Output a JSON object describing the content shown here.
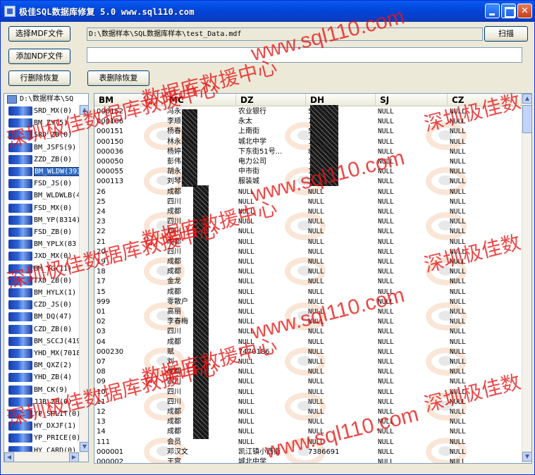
{
  "window": {
    "title": "极佳SQL数据库修复 5.0 www.sql110.com"
  },
  "toolbar": {
    "select_mdf": "选择MDF文件",
    "add_ndf": "添加NDF文件",
    "row_delete_recover": "行删除恢复",
    "table_delete_recover": "表删除恢复",
    "scan": "扫描",
    "mdf_path": "D:\\数据样本\\SQL数据库样本\\test_Data.mdf",
    "ndf_path": ""
  },
  "tree": {
    "root": "D:\\数据样本\\SQ",
    "items": [
      "SRD_MX(0)",
      "BM_ZY(5)",
      "SRD_ZB(0)",
      "BM_JSFS(9)",
      "ZZD_ZB(0)",
      "BM_WLDW(393",
      "FSD_JS(0)",
      "BM_WLDWLB(4",
      "FSD_MX(0)",
      "BM_YP(8314)",
      "FSD_ZB(0)",
      "BM_YPLX(83",
      "JXD_MX(0)",
      "BM_YG(11)",
      "TXD_ZB(0)",
      "BM_HYLX(1)",
      "CZD_JS(0)",
      "BM_DQ(47)",
      "CZD_ZB(0)",
      "BM_SCCJ(419",
      "YHD_MX(7018",
      "BM_QXZ(2)",
      "YHD_ZB(4)",
      "BM_CK(9)",
      "JJB_ZB(0)",
      "YP_SPLIT(0)",
      "HY_DXJF(1)",
      "YP_PRICE(0)",
      "HY_CARD(0)"
    ],
    "selected_index": 5
  },
  "grid": {
    "columns": [
      "BM",
      "MC",
      "DZ",
      "DH",
      "SJ",
      "CZ"
    ],
    "rows": [
      [
        "000152",
        "冯永",
        "农业银行",
        "5",
        "NULL",
        "NULL"
      ],
      [
        "000106",
        "李顺",
        "永太",
        "7",
        "NULL",
        "NULL"
      ],
      [
        "000151",
        "杨春",
        "上南街",
        "5",
        "NULL",
        "NULL"
      ],
      [
        "000150",
        "林永",
        "城北中学",
        "1",
        "NULL",
        "NULL"
      ],
      [
        "000036",
        "杨婷",
        "下东街51号...",
        "8",
        "NULL",
        "NULL"
      ],
      [
        "000050",
        "彭伟",
        "电力公司",
        "1",
        "NULL",
        "NULL"
      ],
      [
        "000055",
        "胡永",
        "中市街",
        "1",
        "NULL",
        "NULL"
      ],
      [
        "000113",
        "刘琴",
        "服装城",
        "1",
        "NULL",
        "NULL"
      ],
      [
        "26",
        "成都",
        "NULL",
        "NULL",
        "NULL",
        "NULL"
      ],
      [
        "25",
        "四川",
        "NULL",
        "NULL",
        "NULL",
        "NULL"
      ],
      [
        "24",
        "成都",
        "NULL",
        "NULL",
        "NULL",
        "NULL"
      ],
      [
        "23",
        "四川",
        "NULL",
        "NULL",
        "NULL",
        "NULL"
      ],
      [
        "22",
        "四川",
        "NULL",
        "NULL",
        "NULL",
        "NULL"
      ],
      [
        "21",
        "成都",
        "NULL",
        "NULL",
        "NULL",
        "NULL"
      ],
      [
        "20",
        "四川",
        "NULL",
        "NULL",
        "NULL",
        "NULL"
      ],
      [
        "19",
        "成都",
        "NULL",
        "NULL",
        "NULL",
        "NULL"
      ],
      [
        "18",
        "成都",
        "NULL",
        "NULL",
        "NULL",
        "NULL"
      ],
      [
        "17",
        "金龙",
        "NULL",
        "NULL",
        "NULL",
        "NULL"
      ],
      [
        "15",
        "成都",
        "NULL",
        "NULL",
        "NULL",
        "NULL"
      ],
      [
        "999",
        "零散户",
        "NULL",
        "NULL",
        "NULL",
        "NULL"
      ],
      [
        "01",
        "高丽",
        "NULL",
        "NULL",
        "NULL",
        "NULL"
      ],
      [
        "02",
        "李春梅",
        "NULL",
        "NULL",
        "NULL",
        "NULL"
      ],
      [
        "03",
        "四川",
        "NULL",
        "NULL",
        "NULL",
        "NULL"
      ],
      [
        "04",
        "成都",
        "NULL",
        "NULL",
        "NULL",
        "NULL"
      ],
      [
        "000230",
        "赋",
        "7470186",
        "NULL",
        "NULL",
        "NULL"
      ],
      [
        "07",
        "刘",
        "NULL",
        "NULL",
        "NULL",
        "NULL"
      ],
      [
        "08",
        "成都",
        "NULL",
        "NULL",
        "NULL",
        "NULL"
      ],
      [
        "09",
        "四川",
        "NULL",
        "NULL",
        "NULL",
        "NULL"
      ],
      [
        "10",
        "四川",
        "NULL",
        "NULL",
        "NULL",
        "NULL"
      ],
      [
        "11",
        "四川",
        "NULL",
        "NULL",
        "NULL",
        "NULL"
      ],
      [
        "12",
        "成都",
        "NULL",
        "NULL",
        "NULL",
        "NULL"
      ],
      [
        "13",
        "成都",
        "NULL",
        "NULL",
        "NULL",
        "NULL"
      ],
      [
        "14",
        "成都",
        "NULL",
        "NULL",
        "NULL",
        "NULL"
      ],
      [
        "111",
        "会员",
        "NULL",
        "NULL",
        "NULL",
        "NULL"
      ],
      [
        "000001",
        "邓汉文",
        "凯江镇小西街",
        "7386691",
        "NULL",
        "NULL"
      ],
      [
        "000002",
        "王宫",
        "城北中学",
        "",
        "NULL",
        "NULL"
      ]
    ]
  },
  "watermarks": {
    "url": "www.sql110.com",
    "cn_short": "数据库救援中心",
    "cn_long": "深圳极佳数据库救援中心",
    "cn_right": "深圳极佳数"
  },
  "colors": {
    "titlebar": "#0245d8",
    "watermark": "#e81414",
    "selection": "#316ac5"
  }
}
